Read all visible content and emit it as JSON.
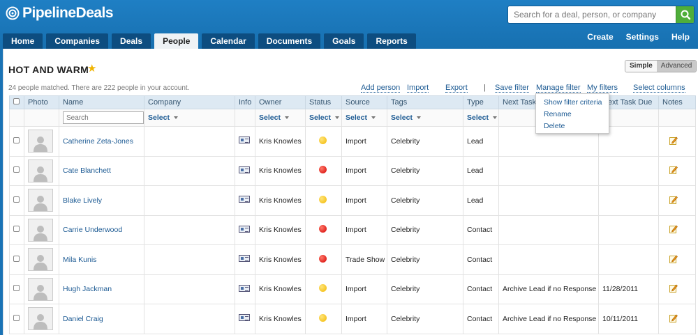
{
  "app": {
    "name": "PipelineDeals"
  },
  "search": {
    "placeholder": "Search for a deal, person, or company"
  },
  "tabs": [
    {
      "label": "Home"
    },
    {
      "label": "Companies"
    },
    {
      "label": "Deals"
    },
    {
      "label": "People"
    },
    {
      "label": "Calendar"
    },
    {
      "label": "Documents"
    },
    {
      "label": "Goals"
    },
    {
      "label": "Reports"
    }
  ],
  "top_links": {
    "create": "Create",
    "settings": "Settings",
    "help": "Help"
  },
  "page": {
    "title": "HOT AND WARM",
    "match_text": "24 people matched. There are 222 people in your account.",
    "mode": {
      "simple": "Simple",
      "advanced": "Advanced"
    }
  },
  "actions": {
    "add_person": "Add person",
    "import": "Import",
    "export": "Export",
    "separator": "|",
    "save_filter": "Save filter",
    "manage_filter": "Manage filter",
    "my_filters": "My filters",
    "select_columns": "Select columns"
  },
  "filter_menu": [
    "Show filter criteria",
    "Rename",
    "Delete"
  ],
  "table": {
    "columns": {
      "photo": "Photo",
      "name": "Name",
      "company": "Company",
      "info": "Info",
      "owner": "Owner",
      "status": "Status",
      "source": "Source",
      "tags": "Tags",
      "type": "Type",
      "next_task": "Next Task",
      "next_task_due": "Next Task Due",
      "notes": "Notes"
    },
    "filters": {
      "search_placeholder": "Search",
      "select_label": "Select"
    },
    "rows": [
      {
        "name": "Catherine Zeta-Jones",
        "owner": "Kris Knowles",
        "status": "yellow",
        "source": "Import",
        "tags": "Celebrity",
        "type": "Lead",
        "next_task": "",
        "due": ""
      },
      {
        "name": "Cate Blanchett",
        "owner": "Kris Knowles",
        "status": "red",
        "source": "Import",
        "tags": "Celebrity",
        "type": "Lead",
        "next_task": "",
        "due": ""
      },
      {
        "name": "Blake Lively",
        "owner": "Kris Knowles",
        "status": "yellow",
        "source": "Import",
        "tags": "Celebrity",
        "type": "Lead",
        "next_task": "",
        "due": ""
      },
      {
        "name": "Carrie Underwood",
        "owner": "Kris Knowles",
        "status": "red",
        "source": "Import",
        "tags": "Celebrity",
        "type": "Contact",
        "next_task": "",
        "due": ""
      },
      {
        "name": "Mila Kunis",
        "owner": "Kris Knowles",
        "status": "red",
        "source": "Trade Show",
        "tags": "Celebrity",
        "type": "Contact",
        "next_task": "",
        "due": ""
      },
      {
        "name": "Hugh Jackman",
        "owner": "Kris Knowles",
        "status": "yellow",
        "source": "Import",
        "tags": "Celebrity",
        "type": "Contact",
        "next_task": "Archive Lead if no Response",
        "due": "11/28/2011"
      },
      {
        "name": "Daniel Craig",
        "owner": "Kris Knowles",
        "status": "yellow",
        "source": "Import",
        "tags": "Celebrity",
        "type": "Contact",
        "next_task": "Archive Lead if no Response",
        "due": "10/11/2011"
      }
    ]
  },
  "colors": {
    "brand_blue": "#1a73b5",
    "status_yellow": "#f2b700",
    "status_red": "#d40000",
    "search_green": "#4fae3a"
  }
}
